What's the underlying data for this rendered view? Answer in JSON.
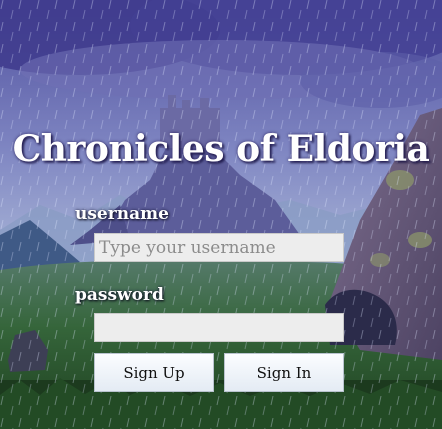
{
  "game": {
    "title": "Chronicles of Eldoria"
  },
  "login": {
    "username_label": "username",
    "username_placeholder": "Type your username",
    "username_value": "",
    "password_label": "password",
    "password_value": "",
    "sign_up_label": "Sign Up",
    "sign_in_label": "Sign In"
  },
  "colors": {
    "sky_top": "#5a5aa8",
    "sky_mid": "#8c93c8",
    "grass": "#2c5a2c",
    "button_face": "#eef3f9"
  }
}
